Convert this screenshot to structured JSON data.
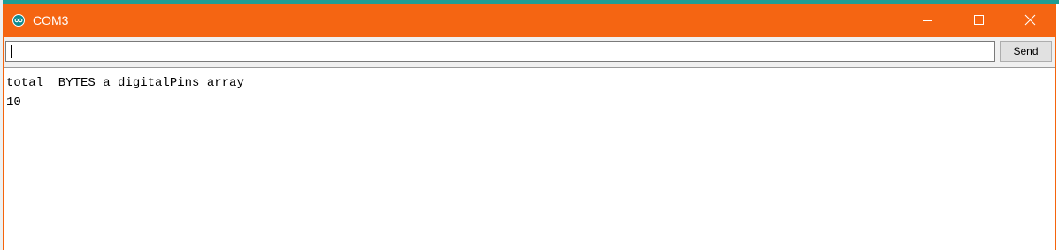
{
  "window": {
    "title": "COM3",
    "app_icon": "arduino-icon",
    "controls": {
      "minimize_icon": "minimize-icon",
      "maximize_icon": "maximize-icon",
      "close_icon": "close-icon"
    },
    "titlebar_color": "#f56512"
  },
  "toolbar": {
    "input_value": "",
    "send_label": "Send"
  },
  "output": {
    "lines": [
      "total  BYTES a digitalPins array",
      "10"
    ]
  }
}
